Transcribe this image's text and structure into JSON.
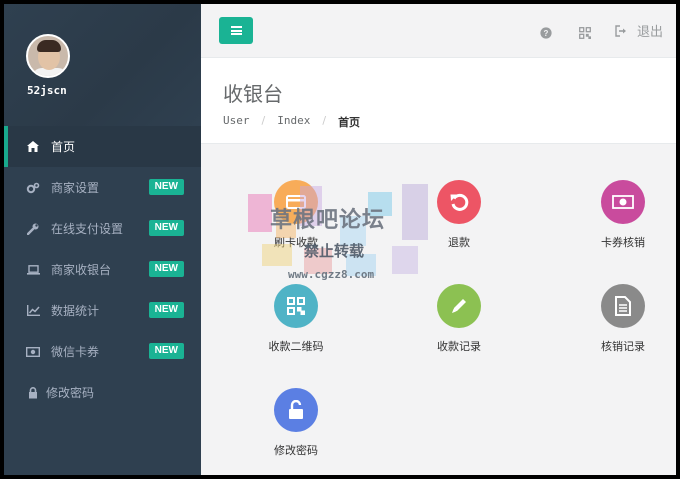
{
  "profile": {
    "username": "52jscn"
  },
  "sidebar": {
    "items": [
      {
        "label": "首页",
        "icon": "home-icon",
        "active": true,
        "badge": ""
      },
      {
        "label": "商家设置",
        "icon": "gears-icon",
        "badge": "NEW"
      },
      {
        "label": "在线支付设置",
        "icon": "wrench-icon",
        "badge": "NEW"
      },
      {
        "label": "商家收银台",
        "icon": "laptop-icon",
        "badge": "NEW"
      },
      {
        "label": "数据统计",
        "icon": "line-chart-icon",
        "badge": "NEW"
      },
      {
        "label": "微信卡券",
        "icon": "money-icon",
        "badge": "NEW"
      },
      {
        "label": "修改密码",
        "icon": "lock-icon",
        "badge": ""
      }
    ]
  },
  "topbar": {
    "logout_label": "退出"
  },
  "heading": {
    "title": "收银台",
    "breadcrumb": [
      "User",
      "Index",
      "首页"
    ]
  },
  "tiles": [
    {
      "label": "刷卡收款",
      "icon": "credit-card-icon",
      "color": "#f8ac59"
    },
    {
      "label": "退款",
      "icon": "undo-icon",
      "color": "#ed5565"
    },
    {
      "label": "卡券核销",
      "icon": "money-icon",
      "color": "#c94b9d"
    },
    {
      "label": "收款二维码",
      "icon": "qrcode-icon",
      "color": "#4fb3c6"
    },
    {
      "label": "收款记录",
      "icon": "pencil-icon",
      "color": "#8cc152"
    },
    {
      "label": "核销记录",
      "icon": "file-icon",
      "color": "#8a8a8a"
    },
    {
      "label": "修改密码",
      "icon": "unlock-icon",
      "color": "#5b7fe3"
    }
  ],
  "watermark": {
    "title": "草根吧论坛",
    "subtitle": "禁止转载",
    "url": "www.cgzz8.com"
  },
  "colors": {
    "accent": "#1ab394",
    "sidebar": "#2f4050"
  }
}
